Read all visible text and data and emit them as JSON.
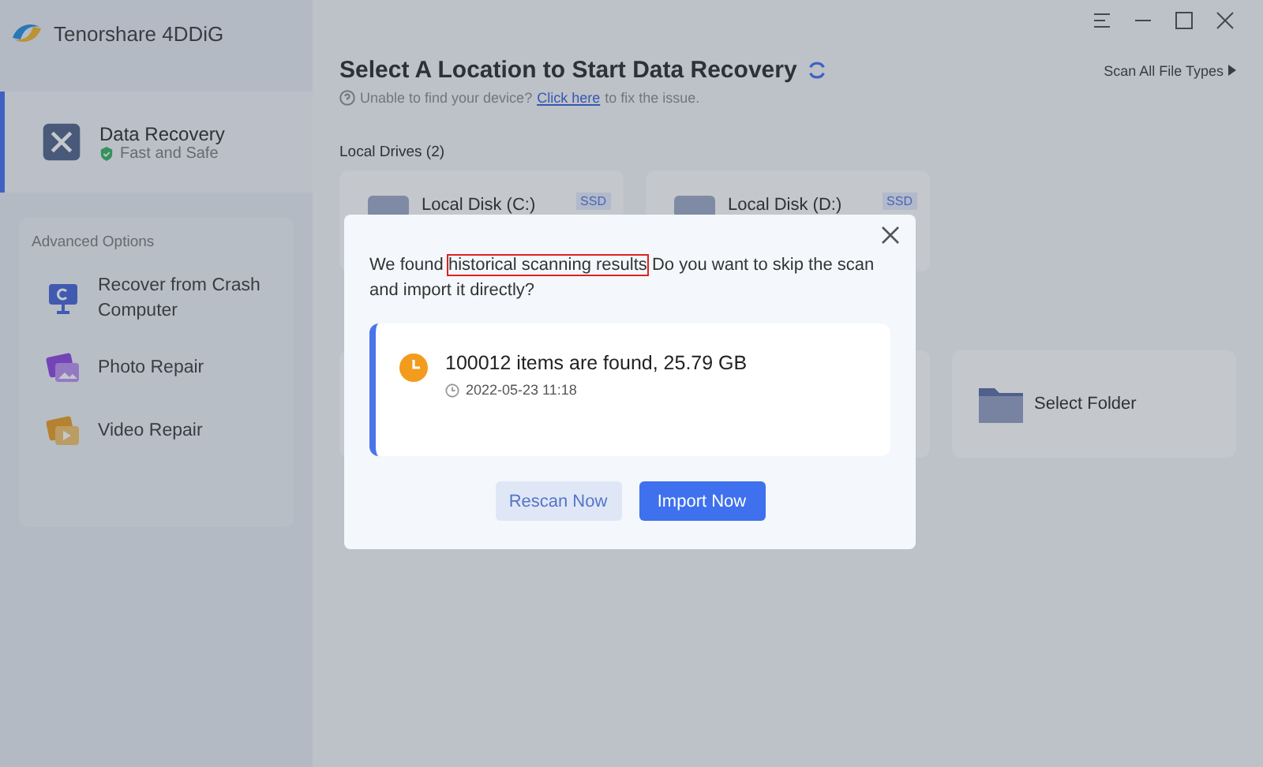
{
  "app": {
    "title": "Tenorshare 4DDiG"
  },
  "sidebar": {
    "items": [
      {
        "label": "Data Recovery",
        "sub": "Fast and Safe",
        "selected": true
      }
    ],
    "advanced": {
      "heading": "Advanced Options",
      "items": [
        {
          "label": "Recover from Crash Computer",
          "kind": "crash"
        },
        {
          "label": "Photo Repair",
          "kind": "photo"
        },
        {
          "label": "Video Repair",
          "kind": "video"
        }
      ]
    }
  },
  "main": {
    "title": "Select A Location to Start Data Recovery",
    "help_before": "Unable to find your device?",
    "help_link": "Click here",
    "help_after": "to fix the issue.",
    "scan_types": "Scan All File Types",
    "local_drives": {
      "heading": "Local Drives (2)",
      "drives": [
        {
          "name": "Local Disk (C:)",
          "badge": "SSD"
        },
        {
          "name": "Local Disk (D:)",
          "badge": "SSD"
        }
      ]
    },
    "locations": [
      {
        "label": "Select Folder"
      }
    ]
  },
  "dialog": {
    "text_before": "We found",
    "highlight": "historical scanning results",
    "text_after": "Do you want to skip the scan and import it directly?",
    "result": "100012 items are found, 25.79 GB",
    "time": "2022-05-23 11:18",
    "buttons": [
      {
        "label": "Rescan Now",
        "kind": "secondary"
      },
      {
        "label": "Import Now",
        "kind": "primary"
      }
    ]
  }
}
